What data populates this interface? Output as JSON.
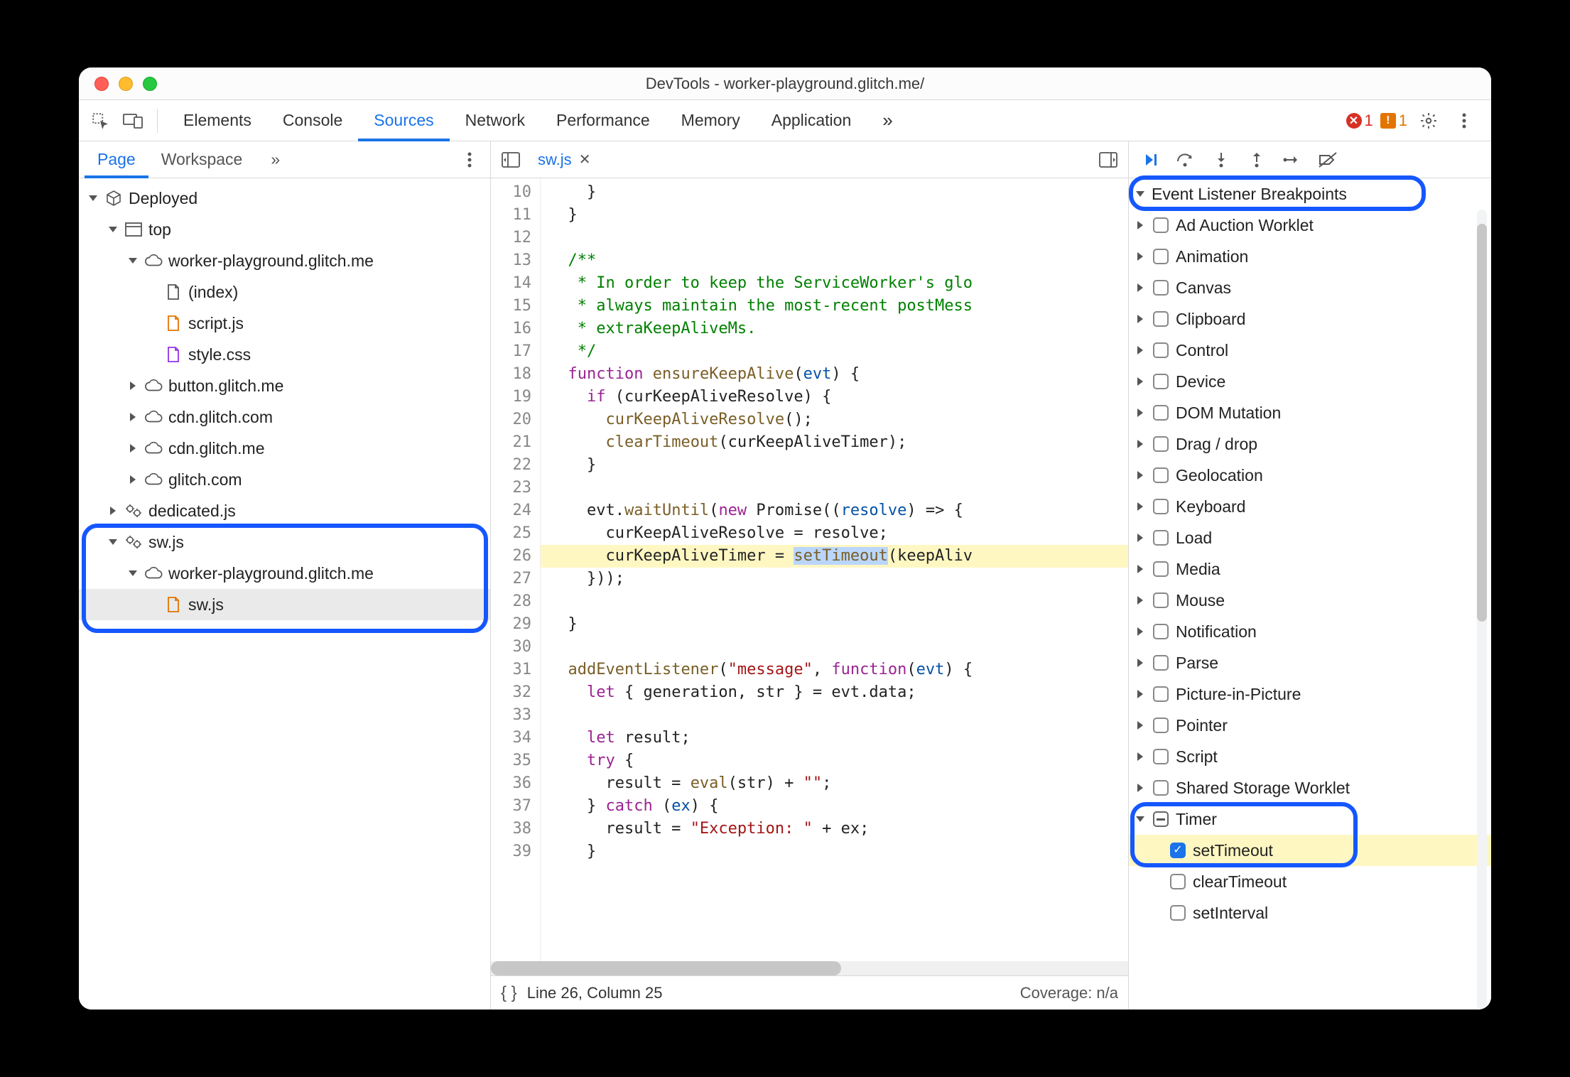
{
  "window": {
    "title": "DevTools - worker-playground.glitch.me/"
  },
  "mainTabs": {
    "items": [
      "Elements",
      "Console",
      "Sources",
      "Network",
      "Performance",
      "Memory",
      "Application"
    ],
    "activeIndex": 2,
    "overflow": "»"
  },
  "errors": {
    "count": "1"
  },
  "warnings": {
    "count": "1"
  },
  "leftPane": {
    "subtabs": {
      "items": [
        "Page",
        "Workspace"
      ],
      "activeIndex": 0,
      "overflow": "»"
    },
    "tree": [
      {
        "depth": 0,
        "icon": "cube",
        "label": "Deployed",
        "expand": "open"
      },
      {
        "depth": 1,
        "icon": "frame",
        "label": "top",
        "expand": "open"
      },
      {
        "depth": 2,
        "icon": "cloud",
        "label": "worker-playground.glitch.me",
        "expand": "open"
      },
      {
        "depth": 3,
        "icon": "file",
        "label": "(index)",
        "expand": "none"
      },
      {
        "depth": 3,
        "icon": "file-js",
        "label": "script.js",
        "expand": "none"
      },
      {
        "depth": 3,
        "icon": "file-css",
        "label": "style.css",
        "expand": "none"
      },
      {
        "depth": 2,
        "icon": "cloud",
        "label": "button.glitch.me",
        "expand": "closed"
      },
      {
        "depth": 2,
        "icon": "cloud",
        "label": "cdn.glitch.com",
        "expand": "closed"
      },
      {
        "depth": 2,
        "icon": "cloud",
        "label": "cdn.glitch.me",
        "expand": "closed"
      },
      {
        "depth": 2,
        "icon": "cloud",
        "label": "glitch.com",
        "expand": "closed"
      },
      {
        "depth": 1,
        "icon": "gears",
        "label": "dedicated.js",
        "expand": "closed"
      },
      {
        "depth": 1,
        "icon": "gears",
        "label": "sw.js",
        "expand": "open"
      },
      {
        "depth": 2,
        "icon": "cloud",
        "label": "worker-playground.glitch.me",
        "expand": "open"
      },
      {
        "depth": 3,
        "icon": "file-js",
        "label": "sw.js",
        "expand": "none",
        "selected": true
      }
    ]
  },
  "editor": {
    "fileName": "sw.js",
    "startLine": 10,
    "highlightedLine": 26,
    "lines": [
      {
        "n": 10,
        "seg": [
          {
            "t": "    }",
            "c": ""
          }
        ]
      },
      {
        "n": 11,
        "seg": [
          {
            "t": "  }",
            "c": ""
          }
        ]
      },
      {
        "n": 12,
        "seg": [
          {
            "t": "",
            "c": ""
          }
        ]
      },
      {
        "n": 13,
        "seg": [
          {
            "t": "  /**",
            "c": "cm"
          }
        ]
      },
      {
        "n": 14,
        "seg": [
          {
            "t": "   * In order to keep the ServiceWorker's glo",
            "c": "cm"
          }
        ]
      },
      {
        "n": 15,
        "seg": [
          {
            "t": "   * always maintain the most-recent postMess",
            "c": "cm"
          }
        ]
      },
      {
        "n": 16,
        "seg": [
          {
            "t": "   * extraKeepAliveMs.",
            "c": "cm"
          }
        ]
      },
      {
        "n": 17,
        "seg": [
          {
            "t": "   */",
            "c": "cm"
          }
        ]
      },
      {
        "n": 18,
        "seg": [
          {
            "t": "  ",
            "c": ""
          },
          {
            "t": "function",
            "c": "kw"
          },
          {
            "t": " ",
            "c": ""
          },
          {
            "t": "ensureKeepAlive",
            "c": "fn"
          },
          {
            "t": "(",
            "c": ""
          },
          {
            "t": "evt",
            "c": "id"
          },
          {
            "t": ") {",
            "c": ""
          }
        ]
      },
      {
        "n": 19,
        "seg": [
          {
            "t": "    ",
            "c": ""
          },
          {
            "t": "if",
            "c": "kw"
          },
          {
            "t": " (curKeepAliveResolve) {",
            "c": ""
          }
        ]
      },
      {
        "n": 20,
        "seg": [
          {
            "t": "      ",
            "c": ""
          },
          {
            "t": "curKeepAliveResolve",
            "c": "fn"
          },
          {
            "t": "();",
            "c": ""
          }
        ]
      },
      {
        "n": 21,
        "seg": [
          {
            "t": "      ",
            "c": ""
          },
          {
            "t": "clearTimeout",
            "c": "fn"
          },
          {
            "t": "(curKeepAliveTimer);",
            "c": ""
          }
        ]
      },
      {
        "n": 22,
        "seg": [
          {
            "t": "    }",
            "c": ""
          }
        ]
      },
      {
        "n": 23,
        "seg": [
          {
            "t": "",
            "c": ""
          }
        ]
      },
      {
        "n": 24,
        "seg": [
          {
            "t": "    evt.",
            "c": ""
          },
          {
            "t": "waitUntil",
            "c": "fn"
          },
          {
            "t": "(",
            "c": ""
          },
          {
            "t": "new",
            "c": "kw"
          },
          {
            "t": " Promise((",
            "c": ""
          },
          {
            "t": "resolve",
            "c": "id"
          },
          {
            "t": ") => {",
            "c": ""
          }
        ]
      },
      {
        "n": 25,
        "seg": [
          {
            "t": "      curKeepAliveResolve = resolve;",
            "c": ""
          }
        ]
      },
      {
        "n": 26,
        "seg": [
          {
            "t": "      curKeepAliveTimer = ",
            "c": ""
          },
          {
            "t": "setTimeout",
            "c": "fn",
            "sel": true
          },
          {
            "t": "(keepAliv",
            "c": ""
          }
        ]
      },
      {
        "n": 27,
        "seg": [
          {
            "t": "    }));",
            "c": ""
          }
        ]
      },
      {
        "n": 28,
        "seg": [
          {
            "t": "",
            "c": ""
          }
        ]
      },
      {
        "n": 29,
        "seg": [
          {
            "t": "  }",
            "c": ""
          }
        ]
      },
      {
        "n": 30,
        "seg": [
          {
            "t": "",
            "c": ""
          }
        ]
      },
      {
        "n": 31,
        "seg": [
          {
            "t": "  ",
            "c": ""
          },
          {
            "t": "addEventListener",
            "c": "fn"
          },
          {
            "t": "(",
            "c": ""
          },
          {
            "t": "\"message\"",
            "c": "str"
          },
          {
            "t": ", ",
            "c": ""
          },
          {
            "t": "function",
            "c": "kw"
          },
          {
            "t": "(",
            "c": ""
          },
          {
            "t": "evt",
            "c": "id"
          },
          {
            "t": ") {",
            "c": ""
          }
        ]
      },
      {
        "n": 32,
        "seg": [
          {
            "t": "    ",
            "c": ""
          },
          {
            "t": "let",
            "c": "kw"
          },
          {
            "t": " { generation, str } = evt.data;",
            "c": ""
          }
        ]
      },
      {
        "n": 33,
        "seg": [
          {
            "t": "",
            "c": ""
          }
        ]
      },
      {
        "n": 34,
        "seg": [
          {
            "t": "    ",
            "c": ""
          },
          {
            "t": "let",
            "c": "kw"
          },
          {
            "t": " result;",
            "c": ""
          }
        ]
      },
      {
        "n": 35,
        "seg": [
          {
            "t": "    ",
            "c": ""
          },
          {
            "t": "try",
            "c": "kw"
          },
          {
            "t": " {",
            "c": ""
          }
        ]
      },
      {
        "n": 36,
        "seg": [
          {
            "t": "      result = ",
            "c": ""
          },
          {
            "t": "eval",
            "c": "fn"
          },
          {
            "t": "(str) + ",
            "c": ""
          },
          {
            "t": "\"\"",
            "c": "str"
          },
          {
            "t": ";",
            "c": ""
          }
        ]
      },
      {
        "n": 37,
        "seg": [
          {
            "t": "    } ",
            "c": ""
          },
          {
            "t": "catch",
            "c": "kw"
          },
          {
            "t": " (",
            "c": ""
          },
          {
            "t": "ex",
            "c": "id"
          },
          {
            "t": ") {",
            "c": ""
          }
        ]
      },
      {
        "n": 38,
        "seg": [
          {
            "t": "      result = ",
            "c": ""
          },
          {
            "t": "\"Exception: \"",
            "c": "str"
          },
          {
            "t": " + ex;",
            "c": ""
          }
        ]
      },
      {
        "n": 39,
        "seg": [
          {
            "t": "    }",
            "c": ""
          }
        ]
      }
    ],
    "status": {
      "pos": "Line 26, Column 25",
      "coverage": "Coverage: n/a"
    }
  },
  "rightPane": {
    "sectionTitle": "Event Listener Breakpoints",
    "categories": [
      {
        "label": "Ad Auction Worklet",
        "state": "unchecked",
        "expand": "closed"
      },
      {
        "label": "Animation",
        "state": "unchecked",
        "expand": "closed"
      },
      {
        "label": "Canvas",
        "state": "unchecked",
        "expand": "closed"
      },
      {
        "label": "Clipboard",
        "state": "unchecked",
        "expand": "closed"
      },
      {
        "label": "Control",
        "state": "unchecked",
        "expand": "closed"
      },
      {
        "label": "Device",
        "state": "unchecked",
        "expand": "closed"
      },
      {
        "label": "DOM Mutation",
        "state": "unchecked",
        "expand": "closed"
      },
      {
        "label": "Drag / drop",
        "state": "unchecked",
        "expand": "closed"
      },
      {
        "label": "Geolocation",
        "state": "unchecked",
        "expand": "closed"
      },
      {
        "label": "Keyboard",
        "state": "unchecked",
        "expand": "closed"
      },
      {
        "label": "Load",
        "state": "unchecked",
        "expand": "closed"
      },
      {
        "label": "Media",
        "state": "unchecked",
        "expand": "closed"
      },
      {
        "label": "Mouse",
        "state": "unchecked",
        "expand": "closed"
      },
      {
        "label": "Notification",
        "state": "unchecked",
        "expand": "closed"
      },
      {
        "label": "Parse",
        "state": "unchecked",
        "expand": "closed"
      },
      {
        "label": "Picture-in-Picture",
        "state": "unchecked",
        "expand": "closed"
      },
      {
        "label": "Pointer",
        "state": "unchecked",
        "expand": "closed"
      },
      {
        "label": "Script",
        "state": "unchecked",
        "expand": "closed"
      },
      {
        "label": "Shared Storage Worklet",
        "state": "unchecked",
        "expand": "closed"
      },
      {
        "label": "Timer",
        "state": "mixed",
        "expand": "open",
        "children": [
          {
            "label": "setTimeout",
            "state": "checked",
            "hl": true
          },
          {
            "label": "clearTimeout",
            "state": "unchecked"
          },
          {
            "label": "setInterval",
            "state": "unchecked"
          }
        ]
      }
    ]
  }
}
